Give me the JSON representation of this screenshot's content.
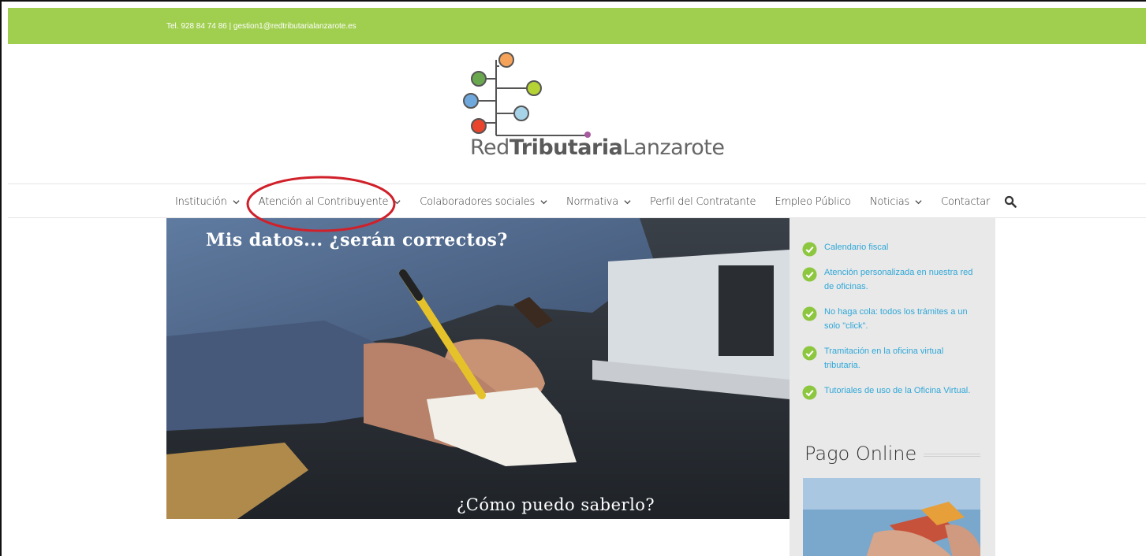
{
  "topbar": {
    "contact": "Tel. 928 84 74 86  |  gestion1@redtributarialanzarote.es"
  },
  "logo": {
    "part1": "Red",
    "part2": "Tributaria",
    "part3": "Lanzarote"
  },
  "nav": {
    "items": [
      {
        "label": "Institución",
        "dropdown": true
      },
      {
        "label": "Atención al Contribuyente",
        "dropdown": true
      },
      {
        "label": "Colaboradores sociales",
        "dropdown": true
      },
      {
        "label": "Normativa",
        "dropdown": true
      },
      {
        "label": "Perfil del Contratante",
        "dropdown": false
      },
      {
        "label": "Empleo Público",
        "dropdown": false
      },
      {
        "label": "Noticias",
        "dropdown": true
      },
      {
        "label": "Contactar",
        "dropdown": false
      }
    ],
    "search_icon": "search-icon"
  },
  "hero": {
    "title": "Mis datos... ¿serán correctos?",
    "subtitle": "¿Cómo puedo saberlo?"
  },
  "sidebar": {
    "items": [
      "Calendario fiscal",
      "Atención personalizada en nuestra red de oficinas.",
      "No haga cola: todos los trámites a un solo \"click\".",
      "Tramitación en la oficina virtual tributaria.",
      "Tutoriales de uso de la Oficina Virtual."
    ],
    "pago_title": "Pago Online"
  },
  "colors": {
    "topbar": "#a0cf4f",
    "link": "#2fa7d8",
    "check": "#8dc63f",
    "annotation": "#d0202a"
  }
}
